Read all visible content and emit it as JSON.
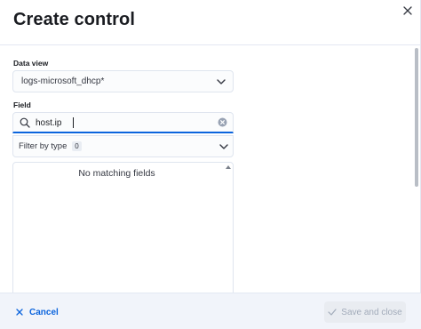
{
  "flyout": {
    "title": "Create control",
    "close_icon": "close-icon"
  },
  "form": {
    "data_view": {
      "label": "Data view",
      "selected": "logs-microsoft_dhcp*",
      "icon": "chevron-down-icon"
    },
    "field": {
      "label": "Field",
      "search_value": "host.ip",
      "search_icon": "search-icon",
      "clear_icon": "clear-icon"
    },
    "filter_by_type": {
      "label": "Filter by type",
      "count": "0",
      "icon": "chevron-down-icon"
    },
    "results": {
      "empty_message": "No matching fields"
    }
  },
  "footer": {
    "cancel_label": "Cancel",
    "save_label": "Save and close",
    "save_disabled": true
  },
  "colors": {
    "accent": "#0b64dd",
    "text": "#1a1c21",
    "footer_bg": "#f1f4fa",
    "disabled_text": "#a2abba"
  }
}
